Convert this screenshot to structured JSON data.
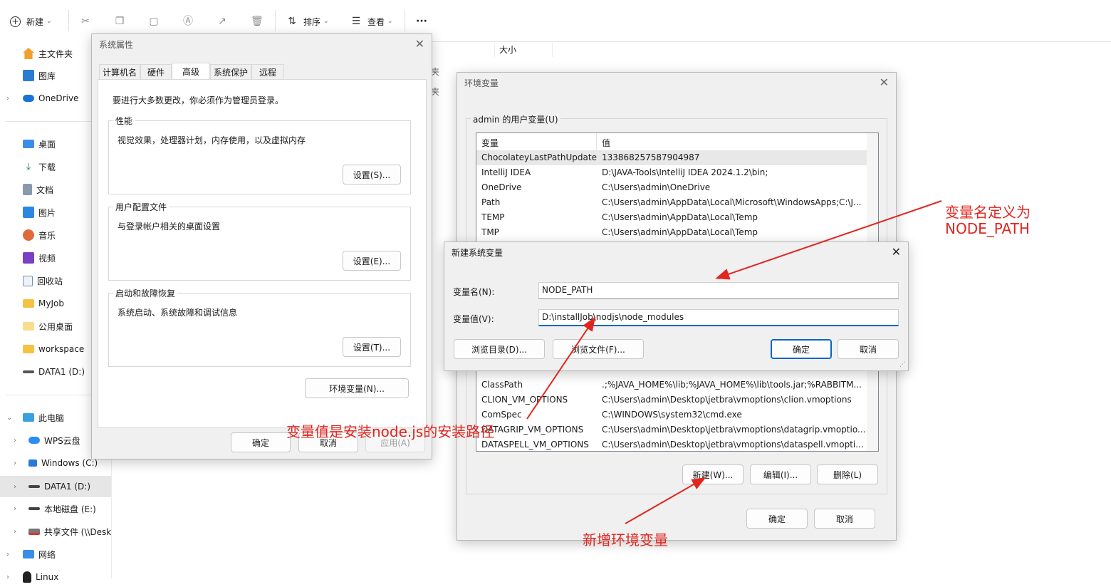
{
  "toolbar": {
    "new_label": "新建",
    "sort_label": "排序",
    "view_label": "查看",
    "more_label": "···"
  },
  "explorer": {
    "size_col": "大小",
    "frag1": "夹",
    "frag2": "夹"
  },
  "sidebar": {
    "items": [
      {
        "label": "主文件夹",
        "icon": "home-icon"
      },
      {
        "label": "图库",
        "icon": "gallery-icon"
      },
      {
        "label": "OneDrive",
        "icon": "cloud-icon"
      },
      {
        "label": "桌面",
        "icon": "desktop-icon"
      },
      {
        "label": "下载",
        "icon": "download-icon"
      },
      {
        "label": "文档",
        "icon": "document-icon"
      },
      {
        "label": "图片",
        "icon": "picture-icon"
      },
      {
        "label": "音乐",
        "icon": "music-icon"
      },
      {
        "label": "视频",
        "icon": "video-icon"
      },
      {
        "label": "回收站",
        "icon": "recycle-bin-icon"
      },
      {
        "label": "MyJob",
        "icon": "folder-icon"
      },
      {
        "label": "公用桌面",
        "icon": "folder-icon"
      },
      {
        "label": "workspace",
        "icon": "folder-icon"
      },
      {
        "label": "DATA1 (D:)",
        "icon": "drive-icon"
      },
      {
        "label": "此电脑",
        "icon": "pc-icon"
      },
      {
        "label": "WPS云盘",
        "icon": "cloud-icon"
      },
      {
        "label": "Windows (C:)",
        "icon": "windows-drive-icon"
      },
      {
        "label": "DATA1 (D:)",
        "icon": "drive-icon"
      },
      {
        "label": "本地磁盘 (E:)",
        "icon": "drive-icon"
      },
      {
        "label": "共享文件 (\\\\Desk",
        "icon": "network-drive-icon"
      },
      {
        "label": "网络",
        "icon": "network-icon"
      },
      {
        "label": "Linux",
        "icon": "linux-icon"
      }
    ]
  },
  "sysprops": {
    "title": "系统属性",
    "tabs": [
      "计算机名",
      "硬件",
      "高级",
      "系统保护",
      "远程"
    ],
    "notice": "要进行大多数更改，你必须作为管理员登录。",
    "perf_label": "性能",
    "perf_desc": "视觉效果，处理器计划，内存使用，以及虚拟内存",
    "perf_btn": "设置(S)...",
    "profile_label": "用户配置文件",
    "profile_desc": "与登录帐户相关的桌面设置",
    "profile_btn": "设置(E)...",
    "startup_label": "启动和故障恢复",
    "startup_desc": "系统启动、系统故障和调试信息",
    "startup_btn": "设置(T)...",
    "env_btn": "环境变量(N)...",
    "ok": "确定",
    "cancel": "取消",
    "apply": "应用(A)"
  },
  "envvars": {
    "title": "环境变量",
    "user_group": "admin 的用户变量(U)",
    "col_var": "变量",
    "col_val": "值",
    "user_rows": [
      {
        "name": "ChocolateyLastPathUpdate",
        "value": "133868257587904987"
      },
      {
        "name": "IntelliJ IDEA",
        "value": "D:\\JAVA-Tools\\IntelliJ IDEA 2024.1.2\\bin;"
      },
      {
        "name": "OneDrive",
        "value": "C:\\Users\\admin\\OneDrive"
      },
      {
        "name": "Path",
        "value": "C:\\Users\\admin\\AppData\\Local\\Microsoft\\WindowsApps;C:\\J..."
      },
      {
        "name": "TEMP",
        "value": "C:\\Users\\admin\\AppData\\Local\\Temp"
      },
      {
        "name": "TMP",
        "value": "C:\\Users\\admin\\AppData\\Local\\Temp"
      }
    ],
    "sys_rows": [
      {
        "name": "ClassPath",
        "value": ".;%JAVA_HOME%\\lib;%JAVA_HOME%\\lib\\tools.jar;%RABBITM..."
      },
      {
        "name": "CLION_VM_OPTIONS",
        "value": "C:\\Users\\admin\\Desktop\\jetbra\\vmoptions\\clion.vmoptions"
      },
      {
        "name": "ComSpec",
        "value": "C:\\WINDOWS\\system32\\cmd.exe"
      },
      {
        "name": "DATAGRIP_VM_OPTIONS",
        "value": "C:\\Users\\admin\\Desktop\\jetbra\\vmoptions\\datagrip.vmoptio..."
      },
      {
        "name": "DATASPELL_VM_OPTIONS",
        "value": "C:\\Users\\admin\\Desktop\\jetbra\\vmoptions\\dataspell.vmopti..."
      }
    ],
    "new_btn": "新建(W)...",
    "edit_btn": "编辑(I)...",
    "delete_btn": "删除(L)",
    "ok": "确定",
    "cancel": "取消"
  },
  "newvar": {
    "title": "新建系统变量",
    "name_label": "变量名(N):",
    "name_value": "NODE_PATH",
    "value_label": "变量值(V):",
    "value_value": "D:\\installJob\\nodjs\\node_modules",
    "browse_dir": "浏览目录(D)...",
    "browse_file": "浏览文件(F)...",
    "ok": "确定",
    "cancel": "取消"
  },
  "annotations": {
    "name_note_1": "变量名定义为",
    "name_note_2": "NODE_PATH",
    "value_note": "变量值是安装node.js的安装路径",
    "new_note": "新增环境变量",
    "color": "#e0261f"
  }
}
